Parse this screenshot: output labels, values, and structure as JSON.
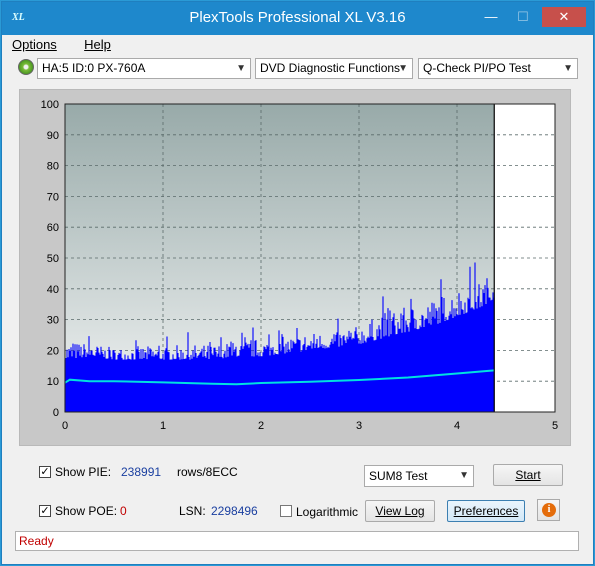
{
  "window": {
    "title": "PlexTools Professional XL V3.16",
    "icon_text": "XL"
  },
  "menu": {
    "options": "Options",
    "help": "Help"
  },
  "toolbar": {
    "drive": "HA:5 ID:0  PX-760A",
    "function": "DVD Diagnostic Functions",
    "test": "Q-Check PI/PO Test"
  },
  "chart_data": {
    "type": "area",
    "xlim": [
      0,
      5
    ],
    "ylim": [
      0,
      100
    ],
    "xticks": [
      "0",
      "1",
      "2",
      "3",
      "4",
      "5"
    ],
    "yticks": [
      "0",
      "10",
      "20",
      "30",
      "40",
      "50",
      "60",
      "70",
      "80",
      "90",
      "100"
    ],
    "grid": true,
    "end_marker_x": 4.38,
    "series": [
      {
        "type": "bars",
        "color": "#0000ff",
        "x": [
          0,
          0.25,
          0.5,
          0.75,
          1.0,
          1.25,
          1.5,
          1.75,
          2.0,
          2.25,
          2.5,
          2.75,
          3.0,
          3.25,
          3.5,
          3.75,
          4.0,
          4.25,
          4.38
        ],
        "y_base": [
          17,
          18,
          17,
          17,
          17,
          17,
          17,
          18,
          18,
          19,
          20,
          21,
          22,
          24,
          26,
          28,
          31,
          34,
          37
        ],
        "y_peak": [
          28,
          26,
          24,
          25,
          25,
          26,
          26,
          27,
          29,
          29,
          31,
          30,
          33,
          39,
          41,
          44,
          48,
          50,
          53
        ]
      },
      {
        "type": "line",
        "color": "#00e0e0",
        "x": [
          0,
          0.05,
          0.25,
          0.5,
          1.0,
          1.5,
          1.75,
          2.0,
          2.5,
          3.0,
          3.5,
          4.0,
          4.38
        ],
        "y": [
          9.5,
          10.5,
          10.0,
          10.0,
          9.6,
          9.2,
          9.0,
          9.4,
          9.8,
          10.4,
          11.2,
          12.5,
          13.5
        ]
      }
    ]
  },
  "controls": {
    "show_pie_label": "Show PIE:",
    "pie_value": "238991",
    "pie_unit": "rows/8ECC",
    "show_poe_label": "Show POE:",
    "poe_value": "0",
    "lsn_label": "LSN:",
    "lsn_value": "2298496",
    "logarithmic_label": "Logarithmic",
    "test_select": "SUM8 Test",
    "start_button": "Start",
    "viewlog_button": "View Log",
    "preferences_button": "Preferences",
    "pie_checked": true,
    "poe_checked": true,
    "log_checked": false
  },
  "status": {
    "text": "Ready"
  }
}
